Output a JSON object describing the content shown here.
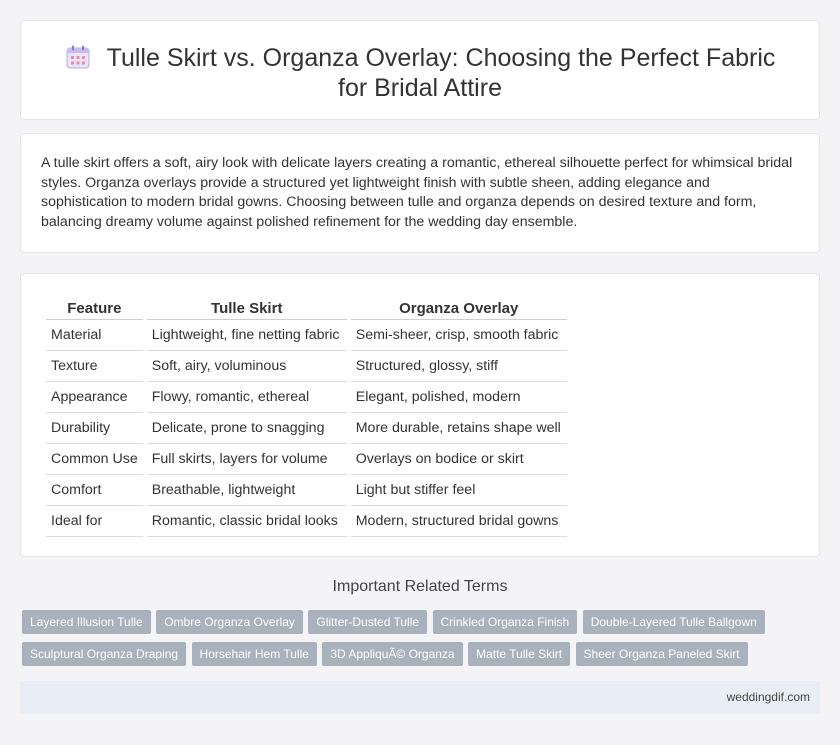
{
  "header": {
    "title": "Tulle Skirt vs. Organza Overlay: Choosing the Perfect Fabric for Bridal Attire",
    "icon": "calendar-icon"
  },
  "intro": {
    "text": "A tulle skirt offers a soft, airy look with delicate layers creating a romantic, ethereal silhouette perfect for whimsical bridal styles. Organza overlays provide a structured yet lightweight finish with subtle sheen, adding elegance and sophistication to modern bridal gowns. Choosing between tulle and organza depends on desired texture and form, balancing dreamy volume against polished refinement for the wedding day ensemble."
  },
  "table": {
    "headers": [
      "Feature",
      "Tulle Skirt",
      "Organza Overlay"
    ],
    "rows": [
      [
        "Material",
        "Lightweight, fine netting fabric",
        "Semi-sheer, crisp, smooth fabric"
      ],
      [
        "Texture",
        "Soft, airy, voluminous",
        "Structured, glossy, stiff"
      ],
      [
        "Appearance",
        "Flowy, romantic, ethereal",
        "Elegant, polished, modern"
      ],
      [
        "Durability",
        "Delicate, prone to snagging",
        "More durable, retains shape well"
      ],
      [
        "Common Use",
        "Full skirts, layers for volume",
        "Overlays on bodice or skirt"
      ],
      [
        "Comfort",
        "Breathable, lightweight",
        "Light but stiffer feel"
      ],
      [
        "Ideal for",
        "Romantic, classic bridal looks",
        "Modern, structured bridal gowns"
      ]
    ]
  },
  "related": {
    "title": "Important Related Terms",
    "tags": [
      "Layered Illusion Tulle",
      "Ombre Organza Overlay",
      "Glitter-Dusted Tulle",
      "Crinkled Organza Finish",
      "Double-Layered Tulle Ballgown",
      "Sculptural Organza Draping",
      "Horsehair Hem Tulle",
      "3D AppliquÃ© Organza",
      "Matte Tulle Skirt",
      "Sheer Organza Paneled Skirt"
    ]
  },
  "footer": {
    "text": "weddingdif.com"
  },
  "colors": {
    "tag_background": "#a9b1bc",
    "footer_background": "#e9eef6",
    "page_background": "#f4f4f6"
  }
}
